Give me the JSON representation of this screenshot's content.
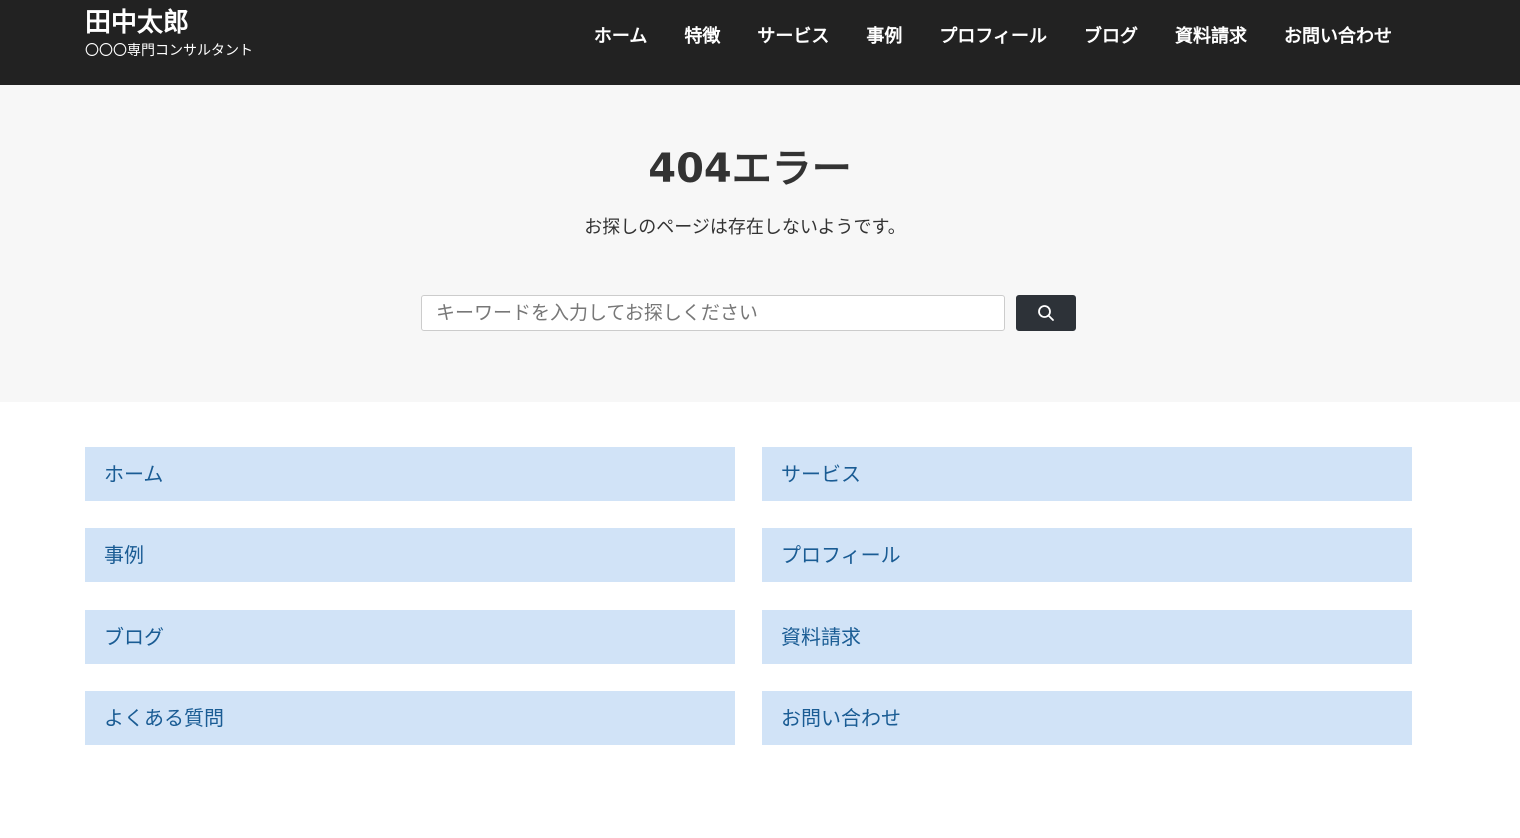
{
  "brand": {
    "title": "田中太郎",
    "subtitle": "〇〇〇専門コンサルタント"
  },
  "nav": [
    {
      "label": "ホーム"
    },
    {
      "label": "特徴"
    },
    {
      "label": "サービス"
    },
    {
      "label": "事例"
    },
    {
      "label": "プロフィール"
    },
    {
      "label": "ブログ"
    },
    {
      "label": "資料請求"
    },
    {
      "label": "お問い合わせ"
    }
  ],
  "error": {
    "title": "404エラー",
    "message": "お探しのページは存在しないようです。"
  },
  "search": {
    "placeholder": "キーワードを入力してお探しください",
    "button_icon": "search-icon"
  },
  "links": [
    {
      "label": "ホーム"
    },
    {
      "label": "サービス"
    },
    {
      "label": "事例"
    },
    {
      "label": "プロフィール"
    },
    {
      "label": "ブログ"
    },
    {
      "label": "資料請求"
    },
    {
      "label": "よくある質問"
    },
    {
      "label": "お問い合わせ"
    }
  ],
  "colors": {
    "header_bg": "#222222",
    "hero_bg": "#f7f7f7",
    "link_bg": "#d1e3f7",
    "link_text": "#1a5c94",
    "button_bg": "#2d3238"
  }
}
